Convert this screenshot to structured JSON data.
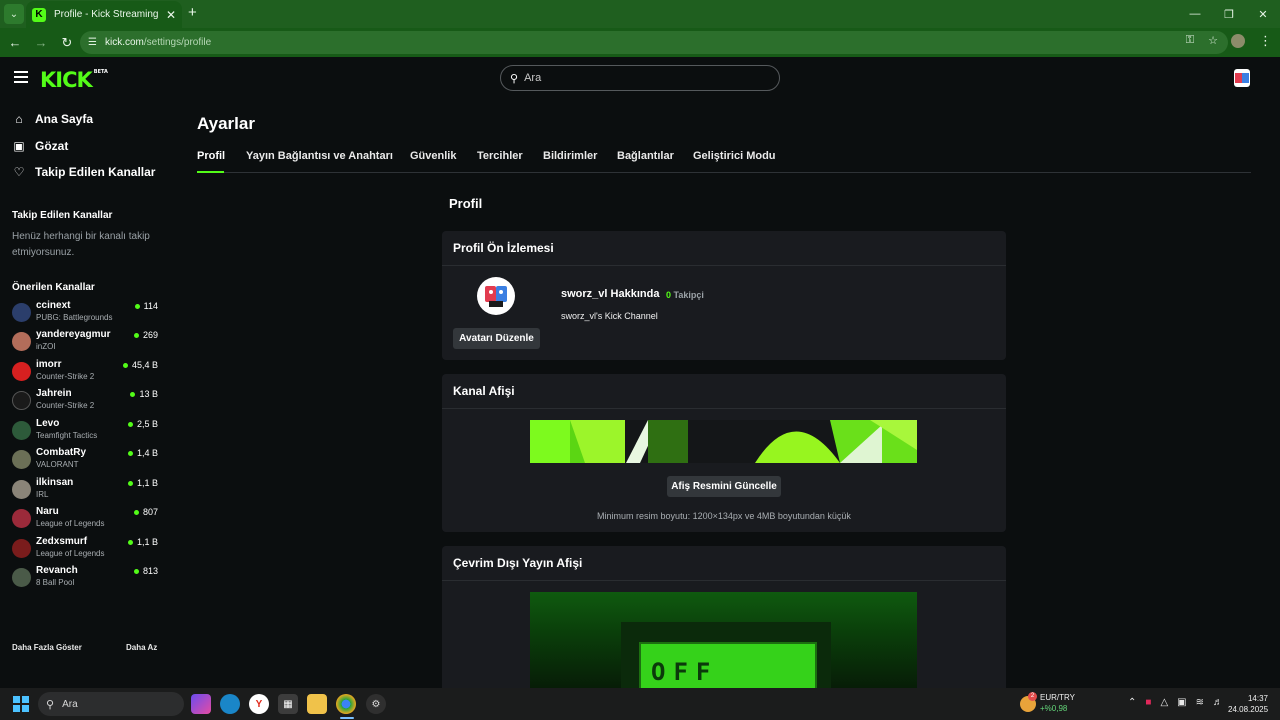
{
  "browser": {
    "tab_title": "Profile - Kick Streaming",
    "url_host": "kick.com",
    "url_path": "/settings/profile"
  },
  "site": {
    "logo_text": "KICK",
    "logo_badge": "BETA",
    "search_placeholder": "Ara",
    "accent_color": "#53fc18"
  },
  "sidebar": {
    "nav": [
      {
        "label": "Ana Sayfa",
        "icon": "home-icon"
      },
      {
        "label": "Gözat",
        "icon": "browse-icon"
      },
      {
        "label": "Takip Edilen Kanallar",
        "icon": "heart-icon"
      }
    ],
    "followed_heading": "Takip Edilen Kanallar",
    "followed_empty": "Henüz herhangi bir kanalı takip etmiyorsunuz.",
    "recommended_heading": "Önerilen Kanallar",
    "channels": [
      {
        "name": "ccinext",
        "game": "PUBG: Battlegrounds",
        "viewers": "114"
      },
      {
        "name": "yandereyagmur",
        "game": "inZOI",
        "viewers": "269"
      },
      {
        "name": "imorr",
        "game": "Counter-Strike 2",
        "viewers": "45,4 B"
      },
      {
        "name": "Jahrein",
        "game": "Counter-Strike 2",
        "viewers": "13 B"
      },
      {
        "name": "Levo",
        "game": "Teamfight Tactics",
        "viewers": "2,5 B"
      },
      {
        "name": "CombatRy",
        "game": "VALORANT",
        "viewers": "1,4 B"
      },
      {
        "name": "ilkinsan",
        "game": "IRL",
        "viewers": "1,1 B"
      },
      {
        "name": "Naru",
        "game": "League of Legends",
        "viewers": "807"
      },
      {
        "name": "Zedxsmurf",
        "game": "League of Legends",
        "viewers": "1,1 B"
      },
      {
        "name": "Revanch",
        "game": "8 Ball Pool",
        "viewers": "813"
      }
    ],
    "show_more": "Daha Fazla Göster",
    "show_less": "Daha Az"
  },
  "main": {
    "page_title": "Ayarlar",
    "tabs": [
      {
        "label": "Profil"
      },
      {
        "label": "Yayın Bağlantısı ve Anahtarı"
      },
      {
        "label": "Güvenlik"
      },
      {
        "label": "Tercihler"
      },
      {
        "label": "Bildirimler"
      },
      {
        "label": "Bağlantılar"
      },
      {
        "label": "Geliştirici Modu"
      }
    ],
    "active_tab": "Profil",
    "section_title": "Profil",
    "preview": {
      "header": "Profil Ön İzlemesi",
      "name": "sworz_vl Hakkında",
      "followers_count": "0",
      "followers_label": "Takipçi",
      "description": "sworz_vl's Kick Channel",
      "edit_avatar": "Avatarı Düzenle"
    },
    "banner": {
      "header": "Kanal Afişi",
      "update_button": "Afiş Resmini Güncelle",
      "hint": "Minimum resim boyutu: 1200×134px ve 4MB boyutundan küçük"
    },
    "offline": {
      "header": "Çevrim Dışı Yayın Afişi",
      "sign_text": "OFF"
    }
  },
  "taskbar": {
    "search_label": "Ara",
    "stock_pair": "EUR/TRY",
    "stock_change": "+%0,98",
    "stock_badge": "2",
    "time": "14:37",
    "date": "24.08.2025"
  }
}
